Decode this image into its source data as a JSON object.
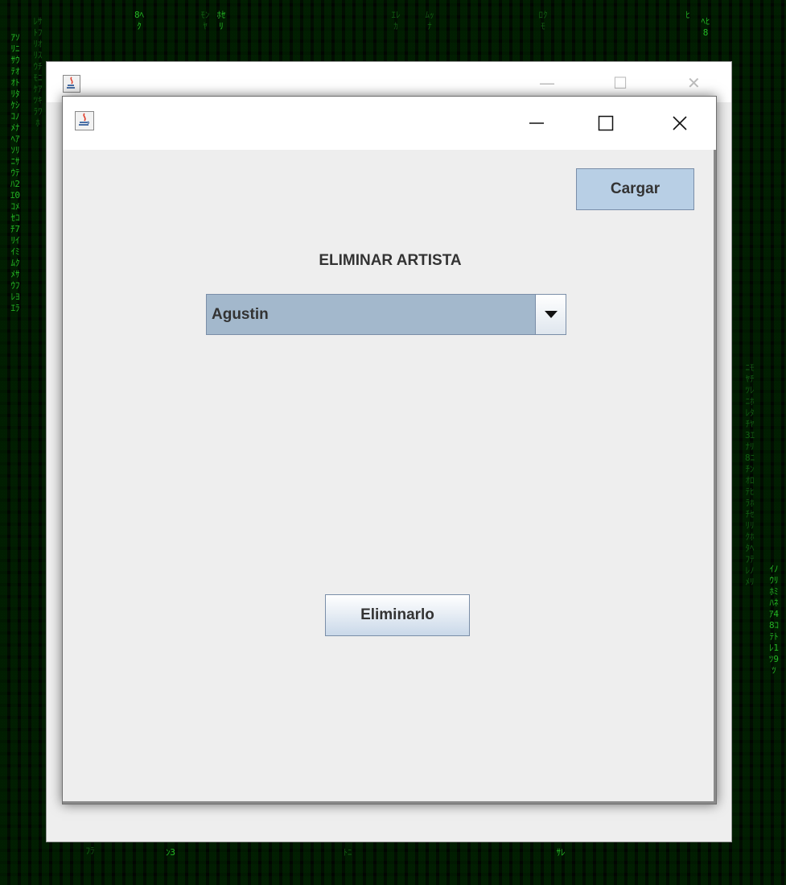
{
  "window": {
    "heading": "ELIMINAR ARTISTA",
    "load_button": "Cargar",
    "delete_button": "Eliminarlo",
    "artist_select": {
      "selected": "Agustin"
    },
    "icons": {
      "app": "java-cup-icon",
      "minimize": "minimize-icon",
      "maximize": "maximize-icon",
      "close": "close-icon",
      "dropdown": "triangle-down-icon"
    }
  },
  "colors": {
    "combo_bg": "#a3b8cc",
    "button_blue": "#b8cfe5",
    "panel_bg": "#eeeeee",
    "desktop_green": "#2bd12b"
  }
}
